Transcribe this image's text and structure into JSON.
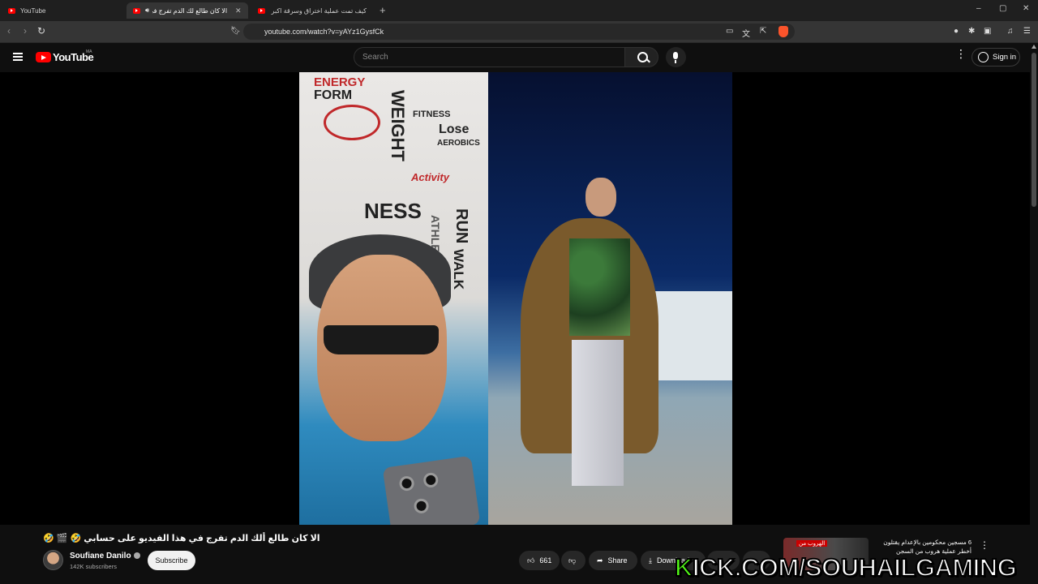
{
  "browser": {
    "tabs": [
      {
        "label": "YouTube"
      },
      {
        "label": "الا كان طالع لك الدم تفرج في"
      },
      {
        "label": "كيف تمت عملية اختراق وسرقة اكبر موا"
      }
    ],
    "new_tab": "+",
    "url": "youtube.com/watch?v=yAYz1GysfCk",
    "window_controls": {
      "minimize": "–",
      "maximize": "▢",
      "close": "✕"
    }
  },
  "header": {
    "logo_word": "YouTube",
    "logo_country": "MA",
    "search_placeholder": "Search",
    "sign_in": "Sign in"
  },
  "video": {
    "title": "الا كان طالع ألك الدم تفرج في هذا الفيديو على حسابي 🤣 🎬 🤣",
    "channel": "Soufiane Danilo",
    "subscribers": "142K subscribers",
    "subscribe_label": "Subscribe",
    "likes": "661",
    "share_label": "Share",
    "download_label": "Download"
  },
  "recommendation": {
    "title": "6 مسجين محكومين بالإعدام يقتلون أخطر عملية هروب من السجن",
    "thumb_label": "الهروب من"
  },
  "overlay": {
    "kick_k": "K",
    "kick_rest": "ICK.COM/SOUHAILGAMING"
  },
  "wall_words": {
    "energy": "ENERGY",
    "form": "FORM",
    "weight": "WEIGHT",
    "fitness": "FITNESS",
    "lose": "Lose",
    "aerobics": "AEROBICS",
    "activity": "Activity",
    "ness": "NESS",
    "run": "RUN",
    "walk": "WALK",
    "athletic": "ATHLETIC"
  },
  "colors": {
    "yt_red": "#ff0000",
    "kick_green": "#53fc18",
    "background": "#0f0f0f"
  }
}
